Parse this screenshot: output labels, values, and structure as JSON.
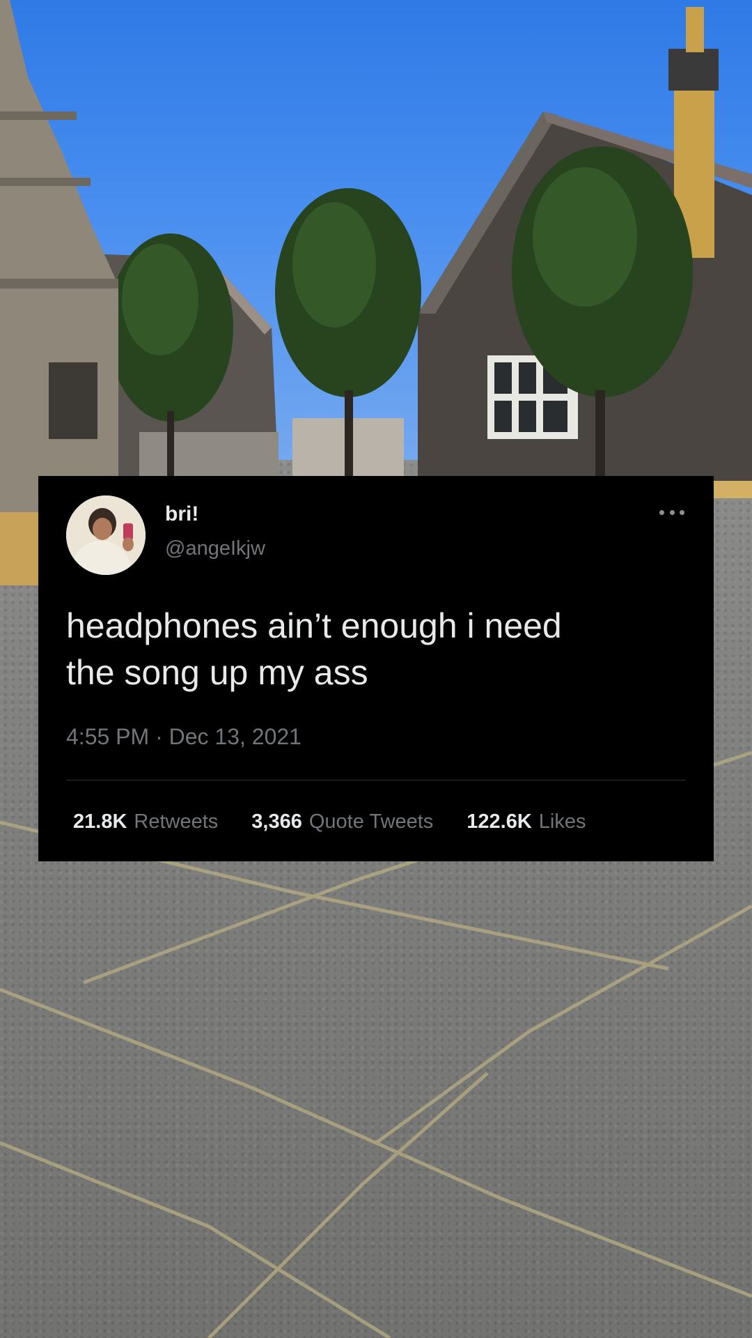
{
  "tweet": {
    "display_name": "bri!",
    "handle": "@angeIkjw",
    "text_line1": "headphones ain’t enough i need",
    "text_line2": "the song up my ass",
    "timestamp": "4:55 PM · Dec 13, 2021",
    "stats": {
      "retweets_count": "21.8K",
      "retweets_label": "Retweets",
      "quotes_count": "3,366",
      "quotes_label": "Quote Tweets",
      "likes_count": "122.6K",
      "likes_label": "Likes"
    },
    "more_icon": "more-horizontal-icon"
  },
  "colors": {
    "card_background": "#000000",
    "primary_text": "#e7e9ea",
    "secondary_text": "#71767b",
    "divider": "#2f3336",
    "sky": "#3a84ec",
    "pavement": "#808080"
  }
}
